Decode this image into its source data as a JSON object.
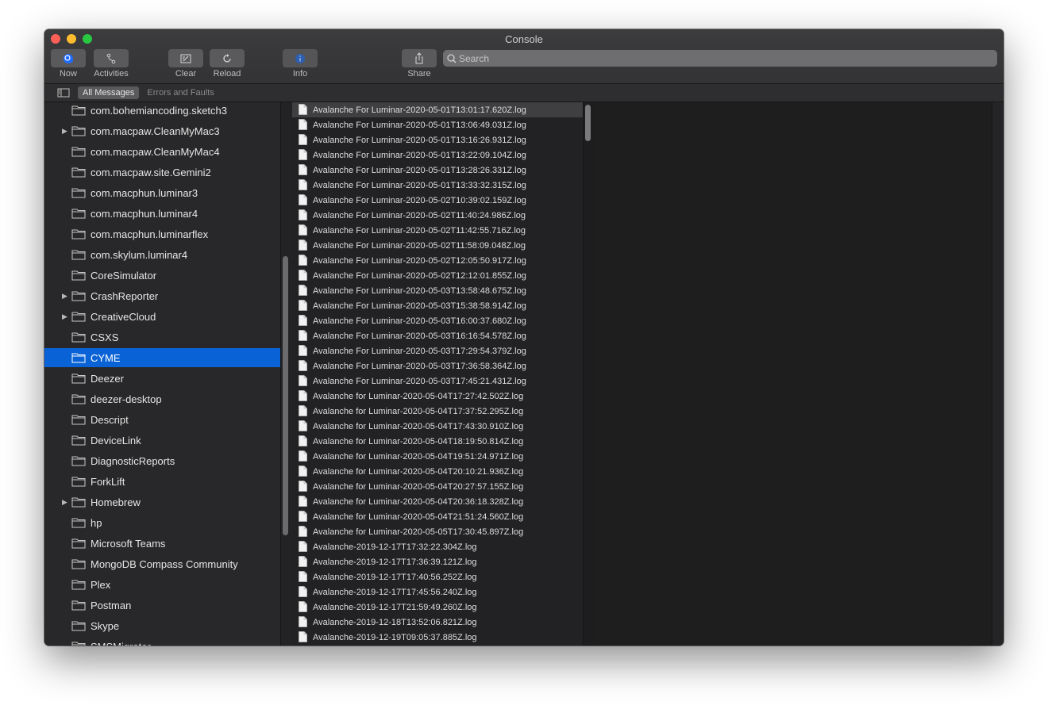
{
  "window": {
    "title": "Console"
  },
  "toolbar": {
    "now_label": "Now",
    "activities_label": "Activities",
    "clear_label": "Clear",
    "reload_label": "Reload",
    "info_label": "Info",
    "share_label": "Share",
    "search_placeholder": "Search"
  },
  "filters": {
    "all_messages": "All Messages",
    "errors_and_faults": "Errors and Faults"
  },
  "colors": {
    "selection": "#0a63d6",
    "accent_blue": "#1e6cff"
  },
  "sidebar": {
    "items": [
      {
        "label": "com.bohemiancoding.sketch3",
        "expandable": false
      },
      {
        "label": "com.macpaw.CleanMyMac3",
        "expandable": true
      },
      {
        "label": "com.macpaw.CleanMyMac4",
        "expandable": false
      },
      {
        "label": "com.macpaw.site.Gemini2",
        "expandable": false
      },
      {
        "label": "com.macphun.luminar3",
        "expandable": false
      },
      {
        "label": "com.macphun.luminar4",
        "expandable": false
      },
      {
        "label": "com.macphun.luminarflex",
        "expandable": false
      },
      {
        "label": "com.skylum.luminar4",
        "expandable": false
      },
      {
        "label": "CoreSimulator",
        "expandable": false
      },
      {
        "label": "CrashReporter",
        "expandable": true
      },
      {
        "label": "CreativeCloud",
        "expandable": true
      },
      {
        "label": "CSXS",
        "expandable": false
      },
      {
        "label": "CYME",
        "expandable": false,
        "selected": true
      },
      {
        "label": "Deezer",
        "expandable": false
      },
      {
        "label": "deezer-desktop",
        "expandable": false
      },
      {
        "label": "Descript",
        "expandable": false
      },
      {
        "label": "DeviceLink",
        "expandable": false
      },
      {
        "label": "DiagnosticReports",
        "expandable": false
      },
      {
        "label": "ForkLift",
        "expandable": false
      },
      {
        "label": "Homebrew",
        "expandable": true
      },
      {
        "label": "hp",
        "expandable": false
      },
      {
        "label": "Microsoft Teams",
        "expandable": false
      },
      {
        "label": "MongoDB Compass Community",
        "expandable": false
      },
      {
        "label": "Plex",
        "expandable": false
      },
      {
        "label": "Postman",
        "expandable": false
      },
      {
        "label": "Skype",
        "expandable": false
      },
      {
        "label": "SMSMigrator",
        "expandable": false
      }
    ]
  },
  "files": {
    "items": [
      "Avalanche For Luminar-2020-05-01T13:01:17.620Z.log",
      "Avalanche For Luminar-2020-05-01T13:06:49.031Z.log",
      "Avalanche For Luminar-2020-05-01T13:16:26.931Z.log",
      "Avalanche For Luminar-2020-05-01T13:22:09.104Z.log",
      "Avalanche For Luminar-2020-05-01T13:28:26.331Z.log",
      "Avalanche For Luminar-2020-05-01T13:33:32.315Z.log",
      "Avalanche For Luminar-2020-05-02T10:39:02.159Z.log",
      "Avalanche For Luminar-2020-05-02T11:40:24.986Z.log",
      "Avalanche For Luminar-2020-05-02T11:42:55.716Z.log",
      "Avalanche For Luminar-2020-05-02T11:58:09.048Z.log",
      "Avalanche For Luminar-2020-05-02T12:05:50.917Z.log",
      "Avalanche For Luminar-2020-05-02T12:12:01.855Z.log",
      "Avalanche For Luminar-2020-05-03T13:58:48.675Z.log",
      "Avalanche For Luminar-2020-05-03T15:38:58.914Z.log",
      "Avalanche For Luminar-2020-05-03T16:00:37.680Z.log",
      "Avalanche For Luminar-2020-05-03T16:16:54.578Z.log",
      "Avalanche For Luminar-2020-05-03T17:29:54.379Z.log",
      "Avalanche For Luminar-2020-05-03T17:36:58.364Z.log",
      "Avalanche For Luminar-2020-05-03T17:45:21.431Z.log",
      "Avalanche for Luminar-2020-05-04T17:27:42.502Z.log",
      "Avalanche for Luminar-2020-05-04T17:37:52.295Z.log",
      "Avalanche for Luminar-2020-05-04T17:43:30.910Z.log",
      "Avalanche for Luminar-2020-05-04T18:19:50.814Z.log",
      "Avalanche for Luminar-2020-05-04T19:51:24.971Z.log",
      "Avalanche for Luminar-2020-05-04T20:10:21.936Z.log",
      "Avalanche for Luminar-2020-05-04T20:27:57.155Z.log",
      "Avalanche for Luminar-2020-05-04T20:36:18.328Z.log",
      "Avalanche for Luminar-2020-05-04T21:51:24.560Z.log",
      "Avalanche for Luminar-2020-05-05T17:30:45.897Z.log",
      "Avalanche-2019-12-17T17:32:22.304Z.log",
      "Avalanche-2019-12-17T17:36:39.121Z.log",
      "Avalanche-2019-12-17T17:40:56.252Z.log",
      "Avalanche-2019-12-17T17:45:56.240Z.log",
      "Avalanche-2019-12-17T21:59:49.260Z.log",
      "Avalanche-2019-12-18T13:52:06.821Z.log",
      "Avalanche-2019-12-19T09:05:37.885Z.log"
    ]
  }
}
